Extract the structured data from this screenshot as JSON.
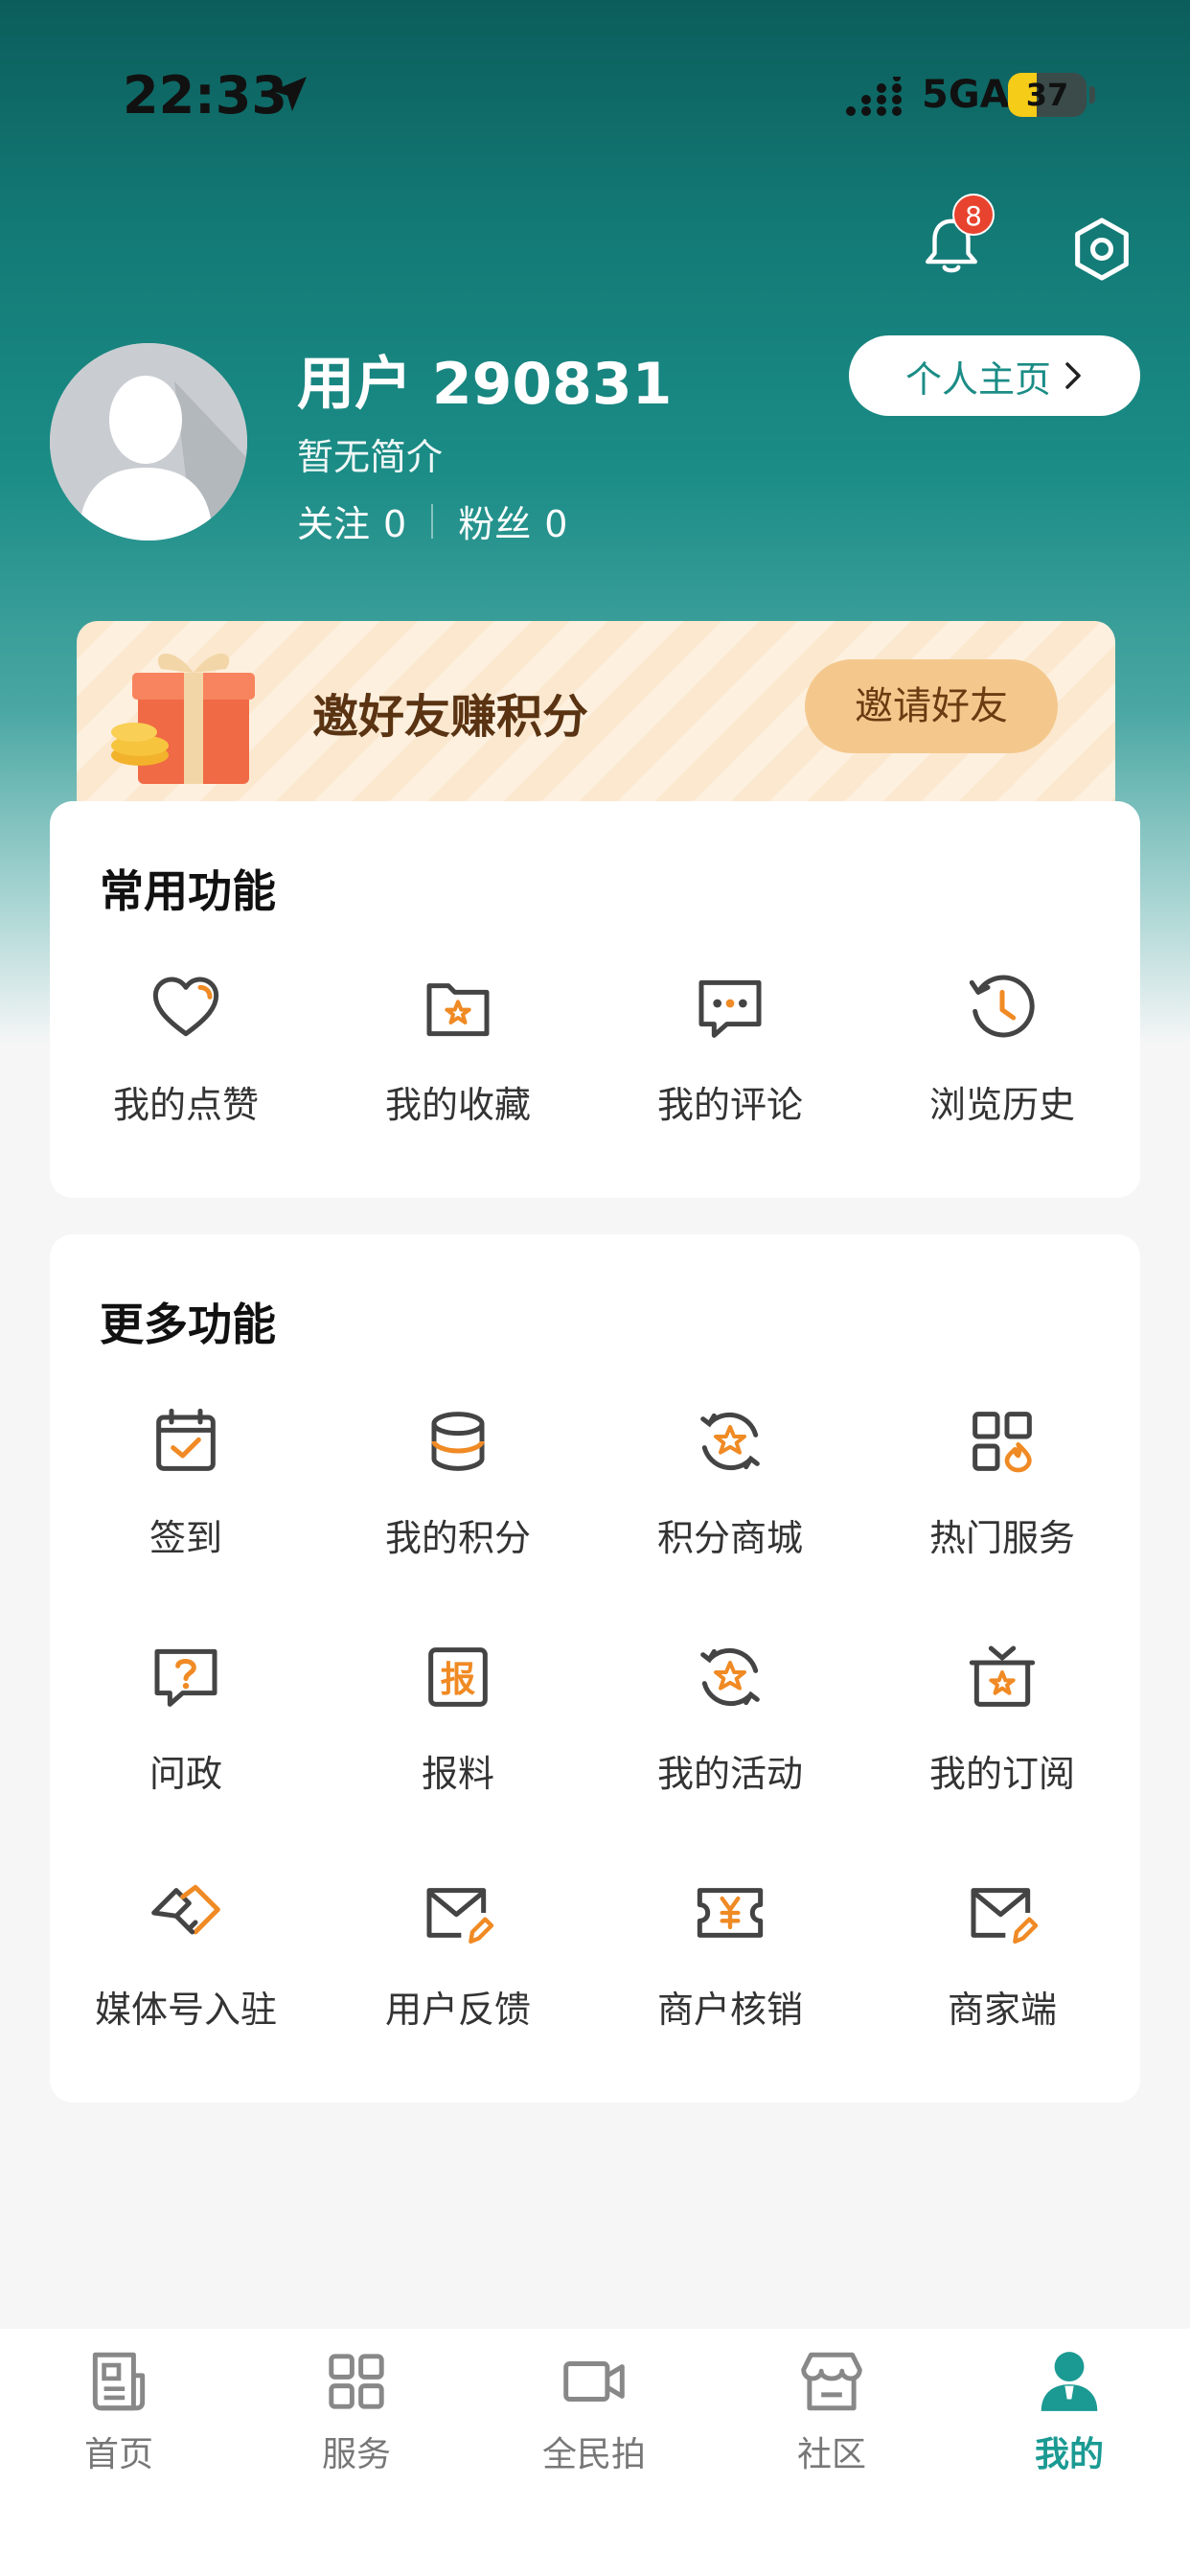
{
  "status_bar": {
    "time": "22:33",
    "network": "5GA",
    "battery": "37",
    "battery_level": 0.37
  },
  "notifications": {
    "badge_count": "8"
  },
  "profile": {
    "username": "用户 290831",
    "bio": "暂无简介",
    "follow_label": "关注",
    "follow_count": "0",
    "fans_label": "粉丝",
    "fans_count": "0",
    "home_button": "个人主页"
  },
  "invite": {
    "title": "邀好友赚积分",
    "button": "邀请好友"
  },
  "common": {
    "title": "常用功能",
    "items": [
      {
        "label": "我的点赞",
        "icon": "heart-icon"
      },
      {
        "label": "我的收藏",
        "icon": "folder-star-icon"
      },
      {
        "label": "我的评论",
        "icon": "comment-icon"
      },
      {
        "label": "浏览历史",
        "icon": "history-icon"
      }
    ]
  },
  "more": {
    "title": "更多功能",
    "items": [
      {
        "label": "签到",
        "icon": "calendar-check-icon"
      },
      {
        "label": "我的积分",
        "icon": "coins-icon"
      },
      {
        "label": "积分商城",
        "icon": "points-mall-icon"
      },
      {
        "label": "热门服务",
        "icon": "hot-service-icon"
      },
      {
        "label": "问政",
        "icon": "question-icon"
      },
      {
        "label": "报料",
        "icon": "report-icon"
      },
      {
        "label": "我的活动",
        "icon": "activity-icon"
      },
      {
        "label": "我的订阅",
        "icon": "subscribe-icon"
      },
      {
        "label": "媒体号入驻",
        "icon": "handshake-icon"
      },
      {
        "label": "用户反馈",
        "icon": "feedback-mail-icon"
      },
      {
        "label": "商户核销",
        "icon": "ticket-yen-icon"
      },
      {
        "label": "商家端",
        "icon": "merchant-mail-icon"
      }
    ]
  },
  "nav": {
    "items": [
      {
        "label": "首页",
        "icon": "news-icon"
      },
      {
        "label": "服务",
        "icon": "grid-icon"
      },
      {
        "label": "全民拍",
        "icon": "video-camera-icon"
      },
      {
        "label": "社区",
        "icon": "store-icon"
      },
      {
        "label": "我的",
        "icon": "user-icon"
      }
    ],
    "active": "我的"
  },
  "colors": {
    "accent": "#1b9a93",
    "icon_orange": "#f08a24",
    "badge": "#e8432e"
  }
}
